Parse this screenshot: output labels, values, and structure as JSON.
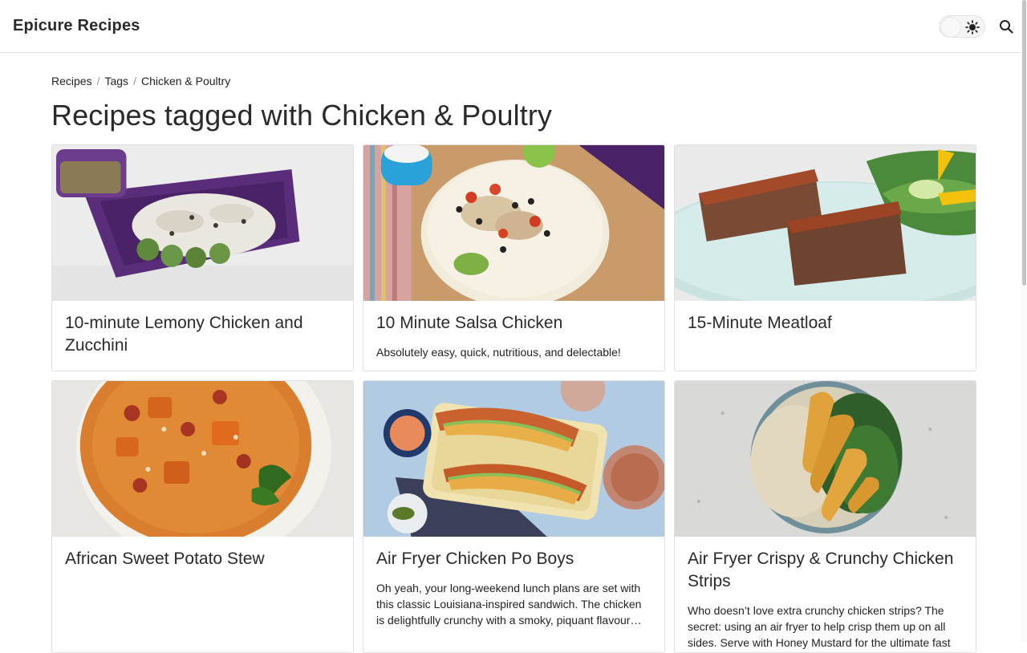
{
  "site": {
    "title": "Epicure Recipes"
  },
  "header": {
    "theme_icon": "sun-icon",
    "search_icon": "search-icon"
  },
  "breadcrumb": [
    "Recipes",
    "Tags",
    "Chicken & Poultry"
  ],
  "page": {
    "title": "Recipes tagged with Chicken & Poultry"
  },
  "cards": [
    {
      "title": "10-minute Lemony Chicken and Zucchini",
      "description": ""
    },
    {
      "title": "10 Minute Salsa Chicken",
      "description": "Absolutely easy, quick, nutritious, and delectable!"
    },
    {
      "title": "15-Minute Meatloaf",
      "description": ""
    },
    {
      "title": "African Sweet Potato Stew",
      "description": ""
    },
    {
      "title": "Air Fryer Chicken Po Boys",
      "description": "Oh yeah, your long-weekend lunch plans are set with this classic Louisiana-inspired sandwich. The chicken is delightfully crunchy with a smoky, piquant flavour…"
    },
    {
      "title": "Air Fryer Crispy & Crunchy Chicken Strips",
      "description": "Who doesn’t love extra crunchy chicken strips? The secret: using an air fryer to help crisp them up on all sides. Serve with Honey Mustard for the ultimate fast"
    }
  ]
}
